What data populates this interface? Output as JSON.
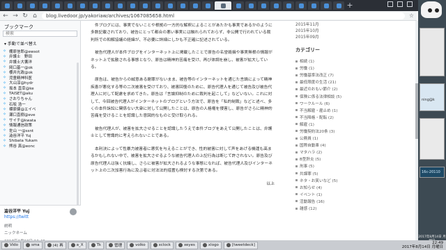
{
  "browser": {
    "url": "blog.livedoor.jp/yakoriaw/archives/1067085658.html"
  },
  "sidebar": {
    "title": "ブックマーク",
    "search_placeholder": "検索",
    "section_label": "▾ 手動で並べ替え",
    "items": [
      "棚原信郎@ewsot",
      "弁護士　野田",
      "弁護士大饗洋",
      "岡口基一@ok",
      "櫻井光政@ok",
      "児童精神科医",
      "大山淳@hydr",
      "坂本 直幸@ke",
      "TAISET@aku",
      "さおりちゃん",
      "石坂 浩一",
      "標原健@エイベ",
      "瀬口直樹@eve",
      "サイチ@kwata",
      "情報通信政策",
      "佐山 一@ssnt",
      "澁谷洋平 Yuj",
      "Shibata Yukam",
      "熊谷 真@eonc"
    ],
    "panel_title": "澁谷洋平 Yuj",
    "panel_link": "https://twitt",
    "panel_note": "説明",
    "panel_date_label": "ニックネーム",
    "panel_date": "2017年2月18日 12:48"
  },
  "article": {
    "paragraphs": [
      "件ブログには、事実でないことや根拠の一方的な解釈によることがあたかも事実であるかのように多数記載されており、被告にとって都合の悪い事実には触れられておらず、非公開で行われている裁判所での和解協議の経緯が、不必要に詳細にしかも不正確に記述されている。",
      "被告代理人が本件ブログをインターネット上に掲載したことで原告の名誉毀損や事実無根の情報がネット上で拡散される事態となり、原告は精神的苦痛を受け、再び体調を崩し、被害が拡大している。",
      "原告は、被告からの誠意ある謝罪がないまま、被告等のインターネットを通じた言論によって精神疾患が悪化する等の二次被害を受けており、被害回復のために、原告代理人を通じて被告及び被告代理人に対して配慮を求めてきた。原告は「言論抑制のために裁判を起こして」などいない。これに対して、今回被告代理人がインターネットのブログという方法で、原告を「私的制裁」などと述べ、多くの本件訴訟に関係ない大衆に対して公開したことは、原告の人格権を侵害し、原告がさらに精神的苦痛を受けることを認識した意図的なものと受け取られる。",
      "被告代理人が、被害を拡大させることを認識したうえで本件ブログをあえて公開したことは、弁護士として常識的に考えられないことである。",
      "本利決によって性暴力被害者に悪気を与えることができ、性的被害に対して声をあげる機運も高まるかもしれない中で、被害を拡大させるような被告代理人の上記行為は断じて許されない。原告及び原告代理人は強く抗議し、さらに被害が拡大されるような事態になれば、被告代理人及びインターネット上の二次加害行為に及ぶ者に対法法的措置も検討する次第である。"
    ],
    "signature": "以上"
  },
  "archive": [
    "2015年11月",
    "2015年10月",
    "2015年09月"
  ],
  "categories": {
    "title": "カテゴリー",
    "items": [
      "相続 (1)",
      "労働 (1)",
      "労働基準法改正 (7)",
      "最低限度の生活 (21)",
      "最近のおもい節介 (2)",
      "保険に係る法律相談 (5)",
      "ワークルール (6)",
      "不当解雇・雇止め (1)",
      "不当降格・配転 (2)",
      "解雇 (1)",
      "労働契約法20条 (3)",
      "公務員 (1)",
      "国際自動車 (4)",
      "マタハラ (2)",
      "B型肝炎 (5)",
      "刑事 (5)",
      "共謀罪 (5)",
      "ネタ・お笑いなど (5)",
      "お知らせ (4)",
      "イベント (1)",
      "活動報告 (16)",
      "雑感 (12)"
    ]
  },
  "taskbar": {
    "tasks": [
      "Vido",
      "sma",
      "(4) 再",
      "a_X",
      "Tk",
      "管理",
      "volko",
      "xclock",
      "xeyes",
      "xlogo",
      "[tweetdeck]"
    ],
    "clock_time": "22:49",
    "clock_date": "2017年8月14日 月曜日"
  },
  "desktop": {
    "labels": [
      "ning@k",
      "16c-20110"
    ],
    "date": "2017年8月14日 月曜日"
  }
}
